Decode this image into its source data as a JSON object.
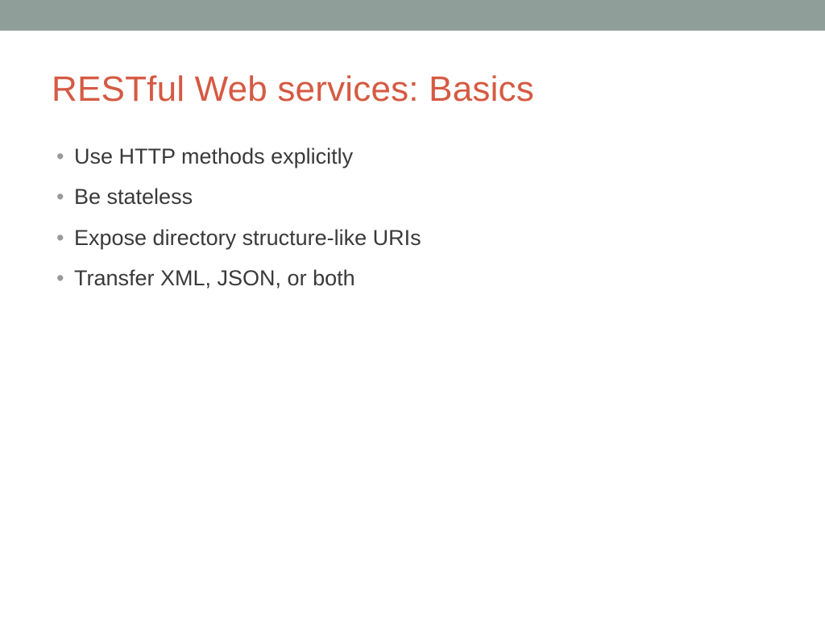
{
  "slide": {
    "title": "RESTful Web services: Basics",
    "bullets": [
      "Use HTTP methods explicitly",
      "Be stateless",
      "Expose directory structure-like URIs",
      "Transfer XML, JSON, or both"
    ]
  },
  "colors": {
    "topBar": "#8f9e98",
    "title": "#d55a43",
    "bodyText": "#3a3a3a",
    "bulletMarker": "#9a9a9a"
  }
}
